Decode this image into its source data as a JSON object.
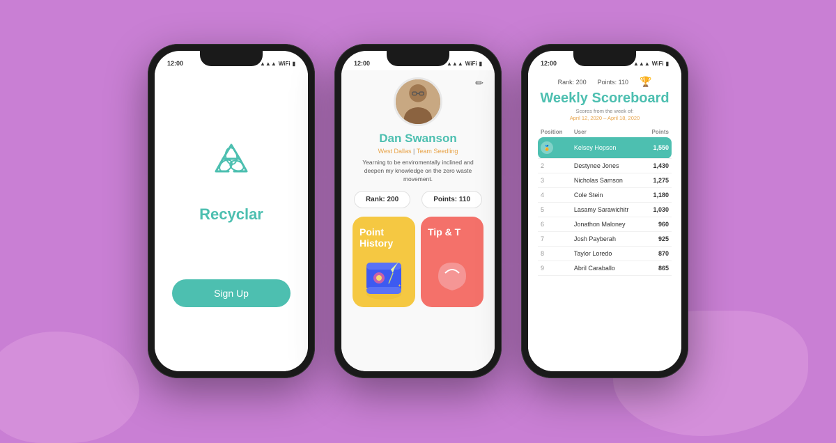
{
  "background": "#c97fd4",
  "phone1": {
    "status_time": "12:00",
    "app_name": "Recyclar",
    "signup_label": "Sign Up",
    "accent_color": "#4dbfb0"
  },
  "phone2": {
    "status_time": "12:00",
    "user_name": "Dan Swanson",
    "location": "West Dallas",
    "team": "Team Seedling",
    "bio": "Yearning to be enviromentally inclined and deepen my knowledge on the zero waste movement.",
    "rank_label": "Rank:",
    "rank_value": "200",
    "points_label": "Points:",
    "points_value": "110",
    "card1_title": "Point History",
    "card2_title": "Tip & T"
  },
  "phone3": {
    "status_time": "12:00",
    "rank_label": "Rank: 200",
    "points_label": "Points: 110",
    "title": "Weekly Scoreboard",
    "subtitle": "Scores from the week of:",
    "date_range": "April 12, 2020 – April 18, 2020",
    "table_headers": [
      "Position",
      "User",
      "Points"
    ],
    "rows": [
      {
        "position": "1",
        "user": "Kelsey Hopson",
        "points": "1,550",
        "first": true
      },
      {
        "position": "2",
        "user": "Destynee Jones",
        "points": "1,430"
      },
      {
        "position": "3",
        "user": "Nicholas Samson",
        "points": "1,275"
      },
      {
        "position": "4",
        "user": "Cole Stein",
        "points": "1,180"
      },
      {
        "position": "5",
        "user": "Lasamy Sarawichitr",
        "points": "1,030"
      },
      {
        "position": "6",
        "user": "Jonathon Maloney",
        "points": "960"
      },
      {
        "position": "7",
        "user": "Josh Payberah",
        "points": "925"
      },
      {
        "position": "8",
        "user": "Taylor Loredo",
        "points": "870"
      },
      {
        "position": "9",
        "user": "Abril Caraballo",
        "points": "865"
      }
    ]
  }
}
